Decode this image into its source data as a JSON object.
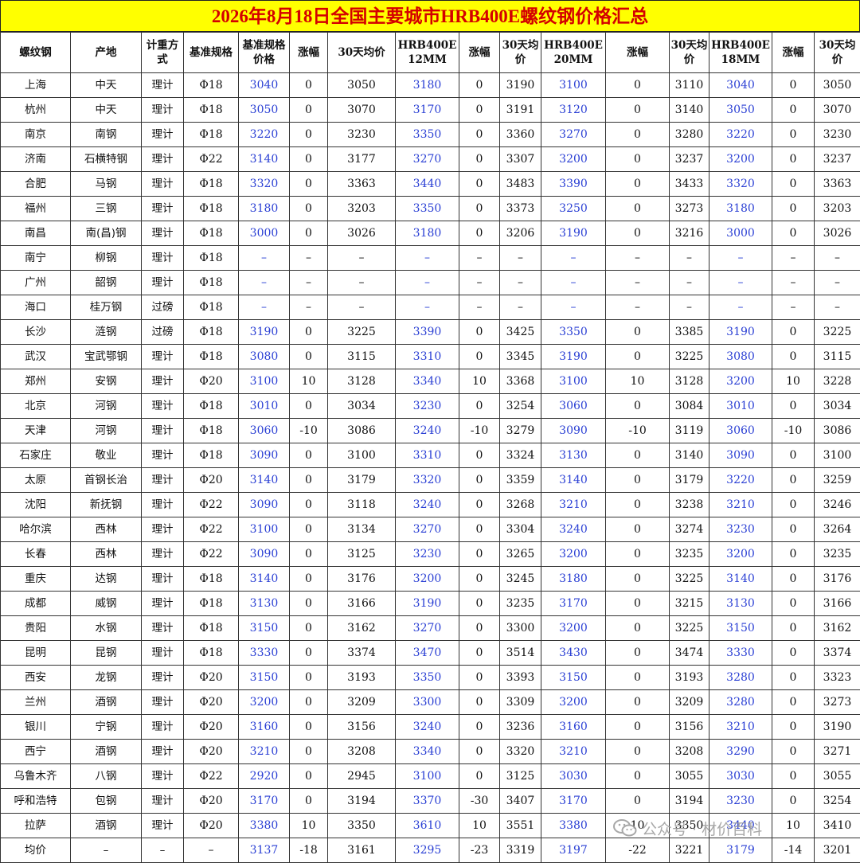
{
  "title": "2026年8月18日全国主要城市HRB400E螺纹钢价格汇总",
  "columns": [
    "螺纹钢",
    "产地",
    "计重方式",
    "基准规格",
    "基准规格价格",
    "涨幅",
    "30天均价",
    "HRB400E 12MM",
    "涨幅",
    "30天均价",
    "HRB400E 20MM",
    "涨幅",
    "30天均价",
    "HRB400E 18MM",
    "涨幅",
    "30天均价"
  ],
  "rows": [
    [
      "上海",
      "中天",
      "理计",
      "Φ18",
      "3040",
      "0",
      "3050",
      "3180",
      "0",
      "3190",
      "3100",
      "0",
      "3110",
      "3040",
      "0",
      "3050"
    ],
    [
      "杭州",
      "中天",
      "理计",
      "Φ18",
      "3050",
      "0",
      "3070",
      "3170",
      "0",
      "3191",
      "3120",
      "0",
      "3140",
      "3050",
      "0",
      "3070"
    ],
    [
      "南京",
      "南钢",
      "理计",
      "Φ18",
      "3220",
      "0",
      "3230",
      "3350",
      "0",
      "3360",
      "3270",
      "0",
      "3280",
      "3220",
      "0",
      "3230"
    ],
    [
      "济南",
      "石横特钢",
      "理计",
      "Φ22",
      "3140",
      "0",
      "3177",
      "3270",
      "0",
      "3307",
      "3200",
      "0",
      "3237",
      "3200",
      "0",
      "3237"
    ],
    [
      "合肥",
      "马钢",
      "理计",
      "Φ18",
      "3320",
      "0",
      "3363",
      "3440",
      "0",
      "3483",
      "3390",
      "0",
      "3433",
      "3320",
      "0",
      "3363"
    ],
    [
      "福州",
      "三钢",
      "理计",
      "Φ18",
      "3180",
      "0",
      "3203",
      "3350",
      "0",
      "3373",
      "3250",
      "0",
      "3273",
      "3180",
      "0",
      "3203"
    ],
    [
      "南昌",
      "南(昌)钢",
      "理计",
      "Φ18",
      "3000",
      "0",
      "3026",
      "3180",
      "0",
      "3206",
      "3190",
      "0",
      "3216",
      "3000",
      "0",
      "3026"
    ],
    [
      "南宁",
      "柳钢",
      "理计",
      "Φ18",
      "–",
      "–",
      "–",
      "–",
      "–",
      "–",
      "–",
      "–",
      "–",
      "–",
      "–",
      "–"
    ],
    [
      "广州",
      "韶钢",
      "理计",
      "Φ18",
      "–",
      "–",
      "–",
      "–",
      "–",
      "–",
      "–",
      "–",
      "–",
      "–",
      "–",
      "–"
    ],
    [
      "海口",
      "桂万钢",
      "过磅",
      "Φ18",
      "–",
      "–",
      "–",
      "–",
      "–",
      "–",
      "–",
      "–",
      "–",
      "–",
      "–",
      "–"
    ],
    [
      "长沙",
      "涟钢",
      "过磅",
      "Φ18",
      "3190",
      "0",
      "3225",
      "3390",
      "0",
      "3425",
      "3350",
      "0",
      "3385",
      "3190",
      "0",
      "3225"
    ],
    [
      "武汉",
      "宝武鄂钢",
      "理计",
      "Φ18",
      "3080",
      "0",
      "3115",
      "3310",
      "0",
      "3345",
      "3190",
      "0",
      "3225",
      "3080",
      "0",
      "3115"
    ],
    [
      "郑州",
      "安钢",
      "理计",
      "Φ20",
      "3100",
      "10",
      "3128",
      "3340",
      "10",
      "3368",
      "3100",
      "10",
      "3128",
      "3200",
      "10",
      "3228"
    ],
    [
      "北京",
      "河钢",
      "理计",
      "Φ18",
      "3010",
      "0",
      "3034",
      "3230",
      "0",
      "3254",
      "3060",
      "0",
      "3084",
      "3010",
      "0",
      "3034"
    ],
    [
      "天津",
      "河钢",
      "理计",
      "Φ18",
      "3060",
      "-10",
      "3086",
      "3240",
      "-10",
      "3279",
      "3090",
      "-10",
      "3119",
      "3060",
      "-10",
      "3086"
    ],
    [
      "石家庄",
      "敬业",
      "理计",
      "Φ18",
      "3090",
      "0",
      "3100",
      "3310",
      "0",
      "3324",
      "3130",
      "0",
      "3140",
      "3090",
      "0",
      "3100"
    ],
    [
      "太原",
      "首钢长治",
      "理计",
      "Φ20",
      "3140",
      "0",
      "3179",
      "3320",
      "0",
      "3359",
      "3140",
      "0",
      "3179",
      "3220",
      "0",
      "3259"
    ],
    [
      "沈阳",
      "新抚钢",
      "理计",
      "Φ22",
      "3090",
      "0",
      "3118",
      "3240",
      "0",
      "3268",
      "3210",
      "0",
      "3238",
      "3210",
      "0",
      "3246"
    ],
    [
      "哈尔滨",
      "西林",
      "理计",
      "Φ22",
      "3100",
      "0",
      "3134",
      "3270",
      "0",
      "3304",
      "3240",
      "0",
      "3274",
      "3230",
      "0",
      "3264"
    ],
    [
      "长春",
      "西林",
      "理计",
      "Φ22",
      "3090",
      "0",
      "3125",
      "3230",
      "0",
      "3265",
      "3200",
      "0",
      "3235",
      "3200",
      "0",
      "3235"
    ],
    [
      "重庆",
      "达钢",
      "理计",
      "Φ18",
      "3140",
      "0",
      "3176",
      "3200",
      "0",
      "3245",
      "3180",
      "0",
      "3225",
      "3140",
      "0",
      "3176"
    ],
    [
      "成都",
      "威钢",
      "理计",
      "Φ18",
      "3130",
      "0",
      "3166",
      "3190",
      "0",
      "3235",
      "3170",
      "0",
      "3215",
      "3130",
      "0",
      "3166"
    ],
    [
      "贵阳",
      "水钢",
      "理计",
      "Φ18",
      "3150",
      "0",
      "3162",
      "3270",
      "0",
      "3300",
      "3200",
      "0",
      "3225",
      "3150",
      "0",
      "3162"
    ],
    [
      "昆明",
      "昆钢",
      "理计",
      "Φ18",
      "3330",
      "0",
      "3374",
      "3470",
      "0",
      "3514",
      "3430",
      "0",
      "3474",
      "3330",
      "0",
      "3374"
    ],
    [
      "西安",
      "龙钢",
      "理计",
      "Φ20",
      "3150",
      "0",
      "3193",
      "3350",
      "0",
      "3393",
      "3150",
      "0",
      "3193",
      "3280",
      "0",
      "3323"
    ],
    [
      "兰州",
      "酒钢",
      "理计",
      "Φ20",
      "3200",
      "0",
      "3209",
      "3300",
      "0",
      "3309",
      "3200",
      "0",
      "3209",
      "3280",
      "0",
      "3273"
    ],
    [
      "银川",
      "宁钢",
      "理计",
      "Φ20",
      "3160",
      "0",
      "3156",
      "3240",
      "0",
      "3236",
      "3160",
      "0",
      "3156",
      "3210",
      "0",
      "3190"
    ],
    [
      "西宁",
      "酒钢",
      "理计",
      "Φ20",
      "3210",
      "0",
      "3208",
      "3340",
      "0",
      "3320",
      "3210",
      "0",
      "3208",
      "3290",
      "0",
      "3271"
    ],
    [
      "乌鲁木齐",
      "八钢",
      "理计",
      "Φ22",
      "2920",
      "0",
      "2945",
      "3100",
      "0",
      "3125",
      "3030",
      "0",
      "3055",
      "3030",
      "0",
      "3055"
    ],
    [
      "呼和浩特",
      "包钢",
      "理计",
      "Φ20",
      "3170",
      "0",
      "3194",
      "3370",
      "-30",
      "3407",
      "3170",
      "0",
      "3194",
      "3230",
      "0",
      "3254"
    ],
    [
      "拉萨",
      "酒钢",
      "理计",
      "Φ20",
      "3380",
      "10",
      "3350",
      "3610",
      "10",
      "3551",
      "3380",
      "10",
      "3350",
      "3440",
      "10",
      "3410"
    ],
    [
      "均价",
      "–",
      "–",
      "–",
      "3137",
      "-18",
      "3161",
      "3295",
      "-23",
      "3319",
      "3197",
      "-22",
      "3221",
      "3179",
      "-14",
      "3201"
    ]
  ],
  "watermark": {
    "icon": "wechat-icon",
    "text": "公众号 · 材价百科"
  },
  "colors": {
    "title_bg": "#ffff00",
    "title_text": "#d40000",
    "price_blue": "#2a3fd4"
  }
}
